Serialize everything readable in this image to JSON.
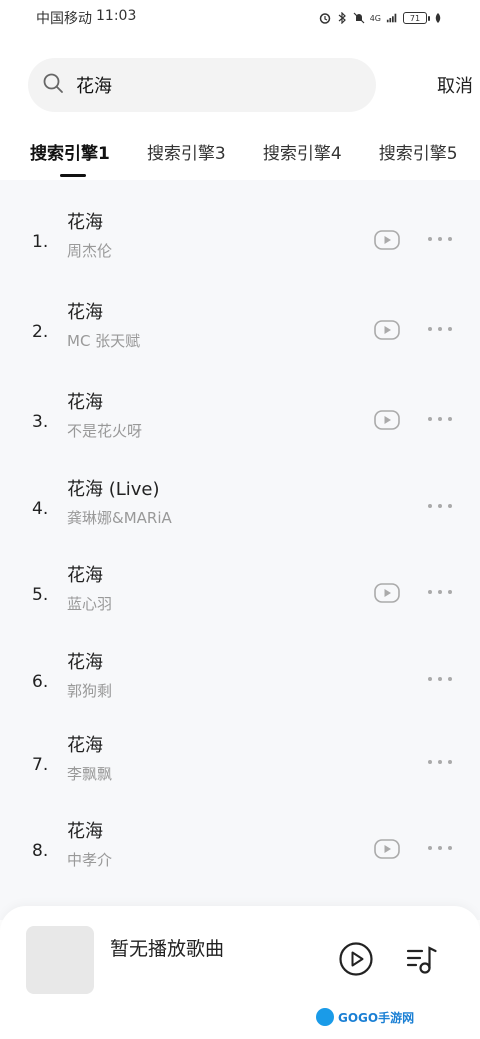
{
  "status": {
    "carrier": "中国移动",
    "time": "11:03",
    "network": "4G",
    "battery": "71"
  },
  "search": {
    "query": "花海",
    "cancel_label": "取消"
  },
  "tabs": [
    {
      "label": "搜索引擎1",
      "active": true
    },
    {
      "label": "搜索引擎3",
      "active": false
    },
    {
      "label": "搜索引擎4",
      "active": false
    },
    {
      "label": "搜索引擎5",
      "active": false
    }
  ],
  "results": [
    {
      "index": "1.",
      "title": "花海",
      "artist": "周杰伦",
      "has_mv": true
    },
    {
      "index": "2.",
      "title": "花海",
      "artist": "MC 张天赋",
      "has_mv": true
    },
    {
      "index": "3.",
      "title": "花海",
      "artist": "不是花火呀",
      "has_mv": true
    },
    {
      "index": "4.",
      "title": "花海 (Live)",
      "artist": "龚琳娜&MARiA",
      "has_mv": false
    },
    {
      "index": "5.",
      "title": "花海",
      "artist": "蓝心羽",
      "has_mv": true
    },
    {
      "index": "6.",
      "title": "花海",
      "artist": "郭狗剩",
      "has_mv": false
    },
    {
      "index": "7.",
      "title": "花海",
      "artist": "李飘飘",
      "has_mv": false
    },
    {
      "index": "8.",
      "title": "花海",
      "artist": "中孝介",
      "has_mv": true
    }
  ],
  "player": {
    "now_playing": "暂无播放歌曲"
  },
  "watermark": "GOGO手游网"
}
